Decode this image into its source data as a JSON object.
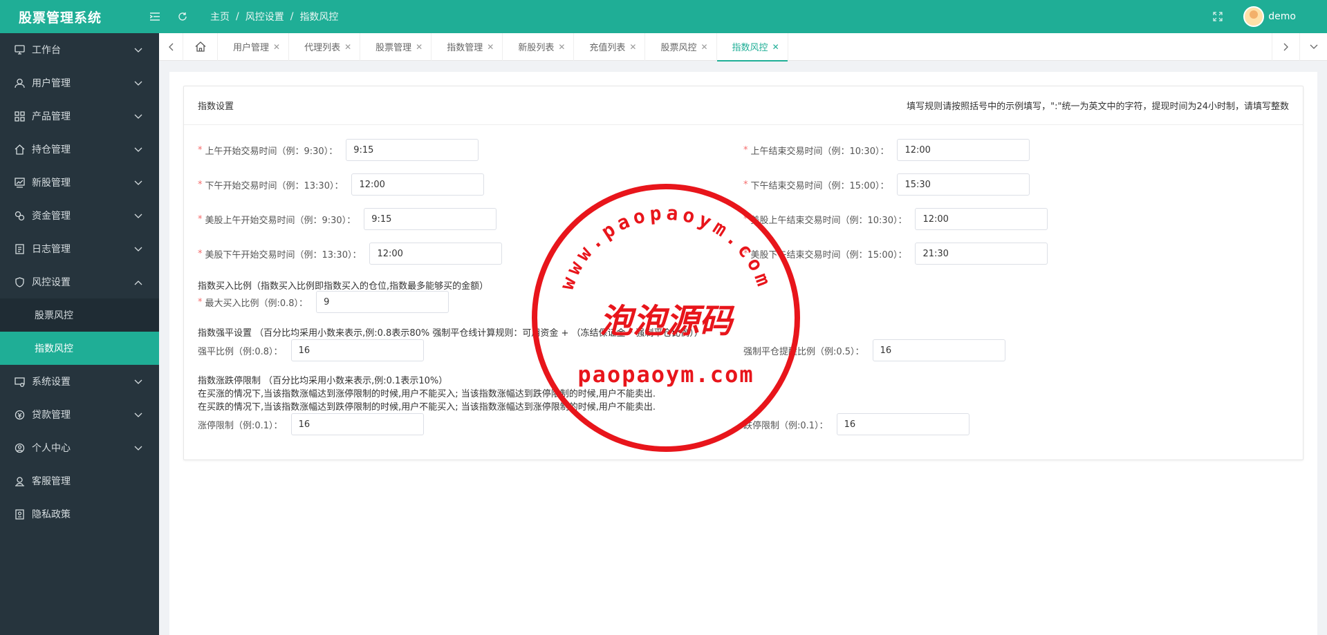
{
  "app": {
    "title": "股票管理系统"
  },
  "breadcrumb": [
    "主页",
    "风控设置",
    "指数风控"
  ],
  "user": {
    "name": "demo"
  },
  "sidebar": {
    "items": [
      {
        "label": "工作台",
        "icon": "monitor-icon",
        "expandable": true
      },
      {
        "label": "用户管理",
        "icon": "user-icon",
        "expandable": true
      },
      {
        "label": "产品管理",
        "icon": "grid-icon",
        "expandable": true
      },
      {
        "label": "持仓管理",
        "icon": "home-icon",
        "expandable": true
      },
      {
        "label": "新股管理",
        "icon": "chart-icon",
        "expandable": true
      },
      {
        "label": "资金管理",
        "icon": "coins-icon",
        "expandable": true
      },
      {
        "label": "日志管理",
        "icon": "log-icon",
        "expandable": true
      },
      {
        "label": "风控设置",
        "icon": "shield-icon",
        "expandable": true,
        "expanded": true
      }
    ],
    "sub": [
      {
        "label": "股票风控",
        "active": false
      },
      {
        "label": "指数风控",
        "active": true
      }
    ],
    "items2": [
      {
        "label": "系统设置",
        "icon": "settings-icon",
        "expandable": true
      },
      {
        "label": "贷款管理",
        "icon": "loan-icon",
        "expandable": true
      },
      {
        "label": "个人中心",
        "icon": "profile-icon",
        "expandable": true
      },
      {
        "label": "客服管理",
        "icon": "support-icon",
        "expandable": false
      },
      {
        "label": "隐私政策",
        "icon": "privacy-icon",
        "expandable": false
      }
    ]
  },
  "tabs": [
    {
      "label": "用户管理"
    },
    {
      "label": "代理列表"
    },
    {
      "label": "股票管理"
    },
    {
      "label": "指数管理"
    },
    {
      "label": "新股列表"
    },
    {
      "label": "充值列表"
    },
    {
      "label": "股票风控"
    },
    {
      "label": "指数风控",
      "active": true
    }
  ],
  "card": {
    "title": "指数设置",
    "note": "填写规则请按照括号中的示例填写，\":\"统一为英文中的字符，提现时间为24小时制，请填写整数"
  },
  "form": {
    "am_start": {
      "label": "上午开始交易时间（例：9:30）：",
      "value": "9:15"
    },
    "am_end": {
      "label": "上午结束交易时间（例：10:30）：",
      "value": "12:00"
    },
    "pm_start": {
      "label": "下午开始交易时间（例：13:30）：",
      "value": "12:00"
    },
    "pm_end": {
      "label": "下午结束交易时间（例：15:00）：",
      "value": "15:30"
    },
    "us_am_start": {
      "label": "美股上午开始交易时间（例：9:30）：",
      "value": "9:15"
    },
    "us_am_end": {
      "label": "美股上午结束交易时间（例：10:30）：",
      "value": "12:00"
    },
    "us_pm_start": {
      "label": "美股下午开始交易时间（例：13:30）：",
      "value": "12:00"
    },
    "us_pm_end": {
      "label": "美股下午结束交易时间（例：15:00）：",
      "value": "21:30"
    },
    "buy_ratio_title": "指数买入比例（指数买入比例即指数买入的仓位,指数最多能够买的金额）",
    "max_buy": {
      "label": "最大买入比例（例:0.8）：",
      "value": "9"
    },
    "force_title": "指数强平设置 （百分比均采用小数来表示,例:0.8表示80% 强制平仓线计算规则：可用资金 + （冻结保证金 * 强制平仓比例））",
    "force_ratio": {
      "label": "强平比例（例:0.8）：",
      "value": "16"
    },
    "force_remind": {
      "label": "强制平仓提醒比例（例:0.5）：",
      "value": "16"
    },
    "limit_title": "指数涨跌停限制 （百分比均采用小数来表示,例:0.1表示10%）",
    "limit_line1": "在买涨的情况下,当该指数涨幅达到涨停限制的时候,用户不能买入; 当该指数涨幅达到跌停限制的时候,用户不能卖出.",
    "limit_line2": "在买跌的情况下,当该指数涨幅达到跌停限制的时候,用户不能买入; 当该指数涨幅达到涨停限制的时候,用户不能卖出.",
    "up_limit": {
      "label": "涨停限制（例:0.1）：",
      "value": "16"
    },
    "down_limit": {
      "label": "跌停限制（例:0.1）：",
      "value": "16"
    }
  },
  "watermark": {
    "top_text": "www.paopaoym.com",
    "center_text": "泡泡源码",
    "bottom_text": "paopaoym.com",
    "color": "#e8151b"
  },
  "colors": {
    "accent": "#1fae96",
    "sidebar": "#26343d"
  }
}
